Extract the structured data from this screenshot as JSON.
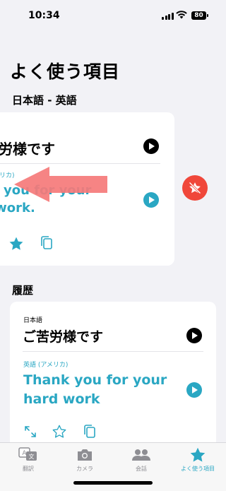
{
  "status": {
    "time": "10:34",
    "battery": "80"
  },
  "page_title": "よく使う項目",
  "favorites": {
    "pair_label": "日本語 - 英語",
    "card": {
      "source_text": "苦労様です",
      "target_lang": "(アメリカ)",
      "target_text": "nk you for your\nd work."
    }
  },
  "history": {
    "section_label": "履歴",
    "card": {
      "source_lang": "日本語",
      "source_text": "ご苦労様です",
      "target_lang": "英語 (アメリカ)",
      "target_text": "Thank you for your\nhard work"
    }
  },
  "tabs": [
    {
      "label": "翻訳",
      "icon": "translate-icon"
    },
    {
      "label": "カメラ",
      "icon": "camera-icon"
    },
    {
      "label": "会話",
      "icon": "conversation-icon"
    },
    {
      "label": "よく使う項目",
      "icon": "star-icon"
    }
  ],
  "colors": {
    "accent": "#2aa7c3",
    "delete": "#f0473a",
    "background": "#f2f2f6"
  }
}
